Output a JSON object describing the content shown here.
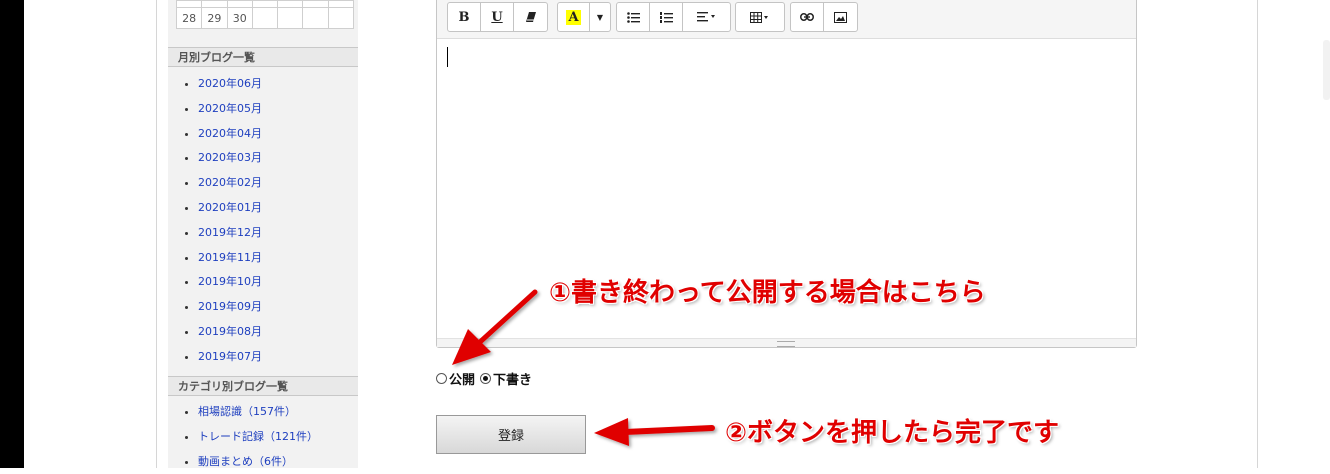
{
  "calendar": {
    "last_row": [
      "28",
      "29",
      "30",
      "",
      "",
      "",
      ""
    ]
  },
  "sidebar": {
    "monthly_heading": "月別ブログ一覧",
    "monthly_items": [
      "2020年06月",
      "2020年05月",
      "2020年04月",
      "2020年03月",
      "2020年02月",
      "2020年01月",
      "2019年12月",
      "2019年11月",
      "2019年10月",
      "2019年09月",
      "2019年08月",
      "2019年07月"
    ],
    "category_heading": "カテゴリ別ブログ一覧",
    "category_items": [
      "相場認識（157件）",
      "トレード記録（121件）",
      "動画まとめ（6件）"
    ]
  },
  "editor": {
    "toolbar": {
      "bold": "B",
      "underline": "U",
      "highlight": "A"
    }
  },
  "publish": {
    "public_label": "公開",
    "draft_label": "下書き",
    "selected": "draft"
  },
  "submit_label": "登録",
  "annotations": {
    "note1": "①書き終わって公開する場合はこちら",
    "note2": "②ボタンを押したら完了です"
  },
  "colors": {
    "annotation": "#e00000",
    "link": "#1e3fbf",
    "highlight": "#ffff00"
  }
}
